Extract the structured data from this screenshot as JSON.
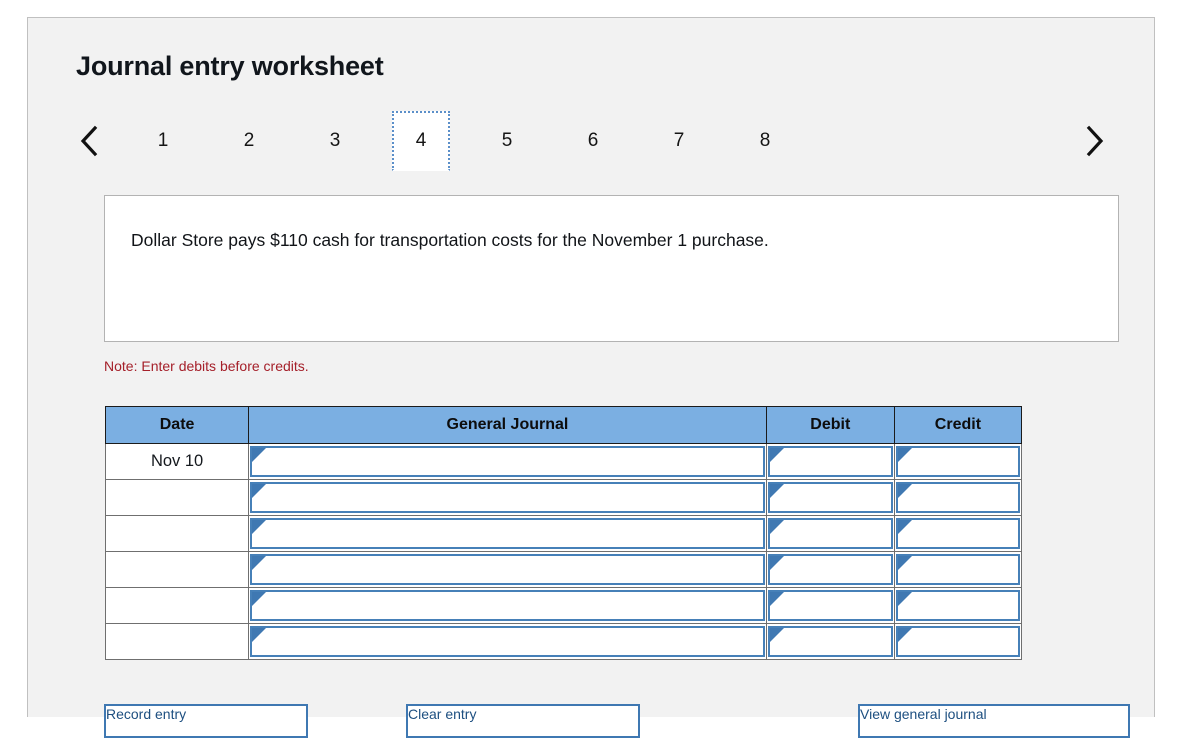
{
  "worksheet": {
    "title": "Journal entry worksheet",
    "nav": {
      "prev_icon": "chevron-left-icon",
      "next_icon": "chevron-right-icon"
    },
    "tabs": [
      {
        "label": "1",
        "selected": false
      },
      {
        "label": "2",
        "selected": false
      },
      {
        "label": "3",
        "selected": false
      },
      {
        "label": "4",
        "selected": true
      },
      {
        "label": "5",
        "selected": false
      },
      {
        "label": "6",
        "selected": false
      },
      {
        "label": "7",
        "selected": false
      },
      {
        "label": "8",
        "selected": false
      }
    ],
    "description": "Dollar Store pays $110 cash for transportation costs for the November 1 purchase.",
    "note": "Note: Enter debits before credits."
  },
  "table": {
    "headers": [
      "Date",
      "General Journal",
      "Debit",
      "Credit"
    ],
    "rows": [
      {
        "date": "Nov 10",
        "general_journal": "",
        "debit": "",
        "credit": ""
      },
      {
        "date": "",
        "general_journal": "",
        "debit": "",
        "credit": ""
      },
      {
        "date": "",
        "general_journal": "",
        "debit": "",
        "credit": ""
      },
      {
        "date": "",
        "general_journal": "",
        "debit": "",
        "credit": ""
      },
      {
        "date": "",
        "general_journal": "",
        "debit": "",
        "credit": ""
      },
      {
        "date": "",
        "general_journal": "",
        "debit": "",
        "credit": ""
      }
    ]
  },
  "buttons": {
    "record": "Record entry",
    "clear": "Clear entry",
    "view": "View general journal"
  },
  "colors": {
    "header_blue": "#7bafe2",
    "input_border_blue": "#4680b8",
    "note_red": "#a5202a",
    "card_bg": "#f2f2f2"
  }
}
